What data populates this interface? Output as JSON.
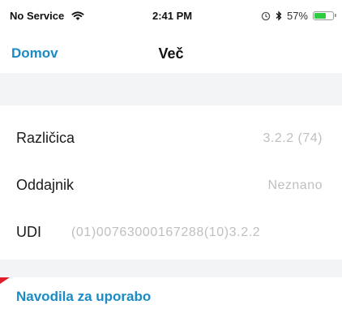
{
  "status_bar": {
    "carrier": "No Service",
    "time": "2:41 PM",
    "battery_text": "57%",
    "battery_level": 0.57,
    "icons": [
      "wifi-icon",
      "alarm-icon",
      "bluetooth-icon",
      "battery-icon"
    ]
  },
  "nav": {
    "back_label": "Domov",
    "title": "Več"
  },
  "info_rows": [
    {
      "label": "Različica",
      "value": "3.2.2 (74)"
    },
    {
      "label": "Oddajnik",
      "value": "Neznano"
    },
    {
      "label": "UDI",
      "value": "(01)00763000167288(10)3.2.2"
    }
  ],
  "links": {
    "manual": "Navodila za uporabo"
  },
  "colors": {
    "accent": "#1a8bc4",
    "value_text": "#bfbfbf",
    "group_background": "#f3f4f6",
    "battery_fill": "#2ecc40",
    "marker": "#e11d2c"
  }
}
